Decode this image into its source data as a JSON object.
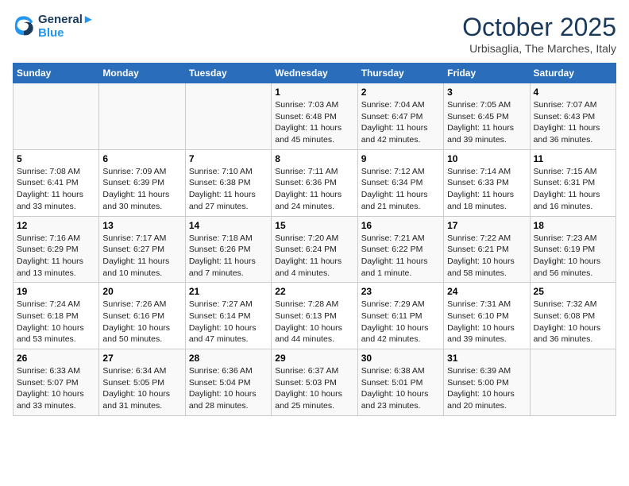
{
  "logo": {
    "line1": "General",
    "line2": "Blue"
  },
  "title": "October 2025",
  "location": "Urbisaglia, The Marches, Italy",
  "headers": [
    "Sunday",
    "Monday",
    "Tuesday",
    "Wednesday",
    "Thursday",
    "Friday",
    "Saturday"
  ],
  "weeks": [
    [
      {
        "day": "",
        "info": ""
      },
      {
        "day": "",
        "info": ""
      },
      {
        "day": "",
        "info": ""
      },
      {
        "day": "1",
        "info": "Sunrise: 7:03 AM\nSunset: 6:48 PM\nDaylight: 11 hours\nand 45 minutes."
      },
      {
        "day": "2",
        "info": "Sunrise: 7:04 AM\nSunset: 6:47 PM\nDaylight: 11 hours\nand 42 minutes."
      },
      {
        "day": "3",
        "info": "Sunrise: 7:05 AM\nSunset: 6:45 PM\nDaylight: 11 hours\nand 39 minutes."
      },
      {
        "day": "4",
        "info": "Sunrise: 7:07 AM\nSunset: 6:43 PM\nDaylight: 11 hours\nand 36 minutes."
      }
    ],
    [
      {
        "day": "5",
        "info": "Sunrise: 7:08 AM\nSunset: 6:41 PM\nDaylight: 11 hours\nand 33 minutes."
      },
      {
        "day": "6",
        "info": "Sunrise: 7:09 AM\nSunset: 6:39 PM\nDaylight: 11 hours\nand 30 minutes."
      },
      {
        "day": "7",
        "info": "Sunrise: 7:10 AM\nSunset: 6:38 PM\nDaylight: 11 hours\nand 27 minutes."
      },
      {
        "day": "8",
        "info": "Sunrise: 7:11 AM\nSunset: 6:36 PM\nDaylight: 11 hours\nand 24 minutes."
      },
      {
        "day": "9",
        "info": "Sunrise: 7:12 AM\nSunset: 6:34 PM\nDaylight: 11 hours\nand 21 minutes."
      },
      {
        "day": "10",
        "info": "Sunrise: 7:14 AM\nSunset: 6:33 PM\nDaylight: 11 hours\nand 18 minutes."
      },
      {
        "day": "11",
        "info": "Sunrise: 7:15 AM\nSunset: 6:31 PM\nDaylight: 11 hours\nand 16 minutes."
      }
    ],
    [
      {
        "day": "12",
        "info": "Sunrise: 7:16 AM\nSunset: 6:29 PM\nDaylight: 11 hours\nand 13 minutes."
      },
      {
        "day": "13",
        "info": "Sunrise: 7:17 AM\nSunset: 6:27 PM\nDaylight: 11 hours\nand 10 minutes."
      },
      {
        "day": "14",
        "info": "Sunrise: 7:18 AM\nSunset: 6:26 PM\nDaylight: 11 hours\nand 7 minutes."
      },
      {
        "day": "15",
        "info": "Sunrise: 7:20 AM\nSunset: 6:24 PM\nDaylight: 11 hours\nand 4 minutes."
      },
      {
        "day": "16",
        "info": "Sunrise: 7:21 AM\nSunset: 6:22 PM\nDaylight: 11 hours\nand 1 minute."
      },
      {
        "day": "17",
        "info": "Sunrise: 7:22 AM\nSunset: 6:21 PM\nDaylight: 10 hours\nand 58 minutes."
      },
      {
        "day": "18",
        "info": "Sunrise: 7:23 AM\nSunset: 6:19 PM\nDaylight: 10 hours\nand 56 minutes."
      }
    ],
    [
      {
        "day": "19",
        "info": "Sunrise: 7:24 AM\nSunset: 6:18 PM\nDaylight: 10 hours\nand 53 minutes."
      },
      {
        "day": "20",
        "info": "Sunrise: 7:26 AM\nSunset: 6:16 PM\nDaylight: 10 hours\nand 50 minutes."
      },
      {
        "day": "21",
        "info": "Sunrise: 7:27 AM\nSunset: 6:14 PM\nDaylight: 10 hours\nand 47 minutes."
      },
      {
        "day": "22",
        "info": "Sunrise: 7:28 AM\nSunset: 6:13 PM\nDaylight: 10 hours\nand 44 minutes."
      },
      {
        "day": "23",
        "info": "Sunrise: 7:29 AM\nSunset: 6:11 PM\nDaylight: 10 hours\nand 42 minutes."
      },
      {
        "day": "24",
        "info": "Sunrise: 7:31 AM\nSunset: 6:10 PM\nDaylight: 10 hours\nand 39 minutes."
      },
      {
        "day": "25",
        "info": "Sunrise: 7:32 AM\nSunset: 6:08 PM\nDaylight: 10 hours\nand 36 minutes."
      }
    ],
    [
      {
        "day": "26",
        "info": "Sunrise: 6:33 AM\nSunset: 5:07 PM\nDaylight: 10 hours\nand 33 minutes."
      },
      {
        "day": "27",
        "info": "Sunrise: 6:34 AM\nSunset: 5:05 PM\nDaylight: 10 hours\nand 31 minutes."
      },
      {
        "day": "28",
        "info": "Sunrise: 6:36 AM\nSunset: 5:04 PM\nDaylight: 10 hours\nand 28 minutes."
      },
      {
        "day": "29",
        "info": "Sunrise: 6:37 AM\nSunset: 5:03 PM\nDaylight: 10 hours\nand 25 minutes."
      },
      {
        "day": "30",
        "info": "Sunrise: 6:38 AM\nSunset: 5:01 PM\nDaylight: 10 hours\nand 23 minutes."
      },
      {
        "day": "31",
        "info": "Sunrise: 6:39 AM\nSunset: 5:00 PM\nDaylight: 10 hours\nand 20 minutes."
      },
      {
        "day": "",
        "info": ""
      }
    ]
  ]
}
